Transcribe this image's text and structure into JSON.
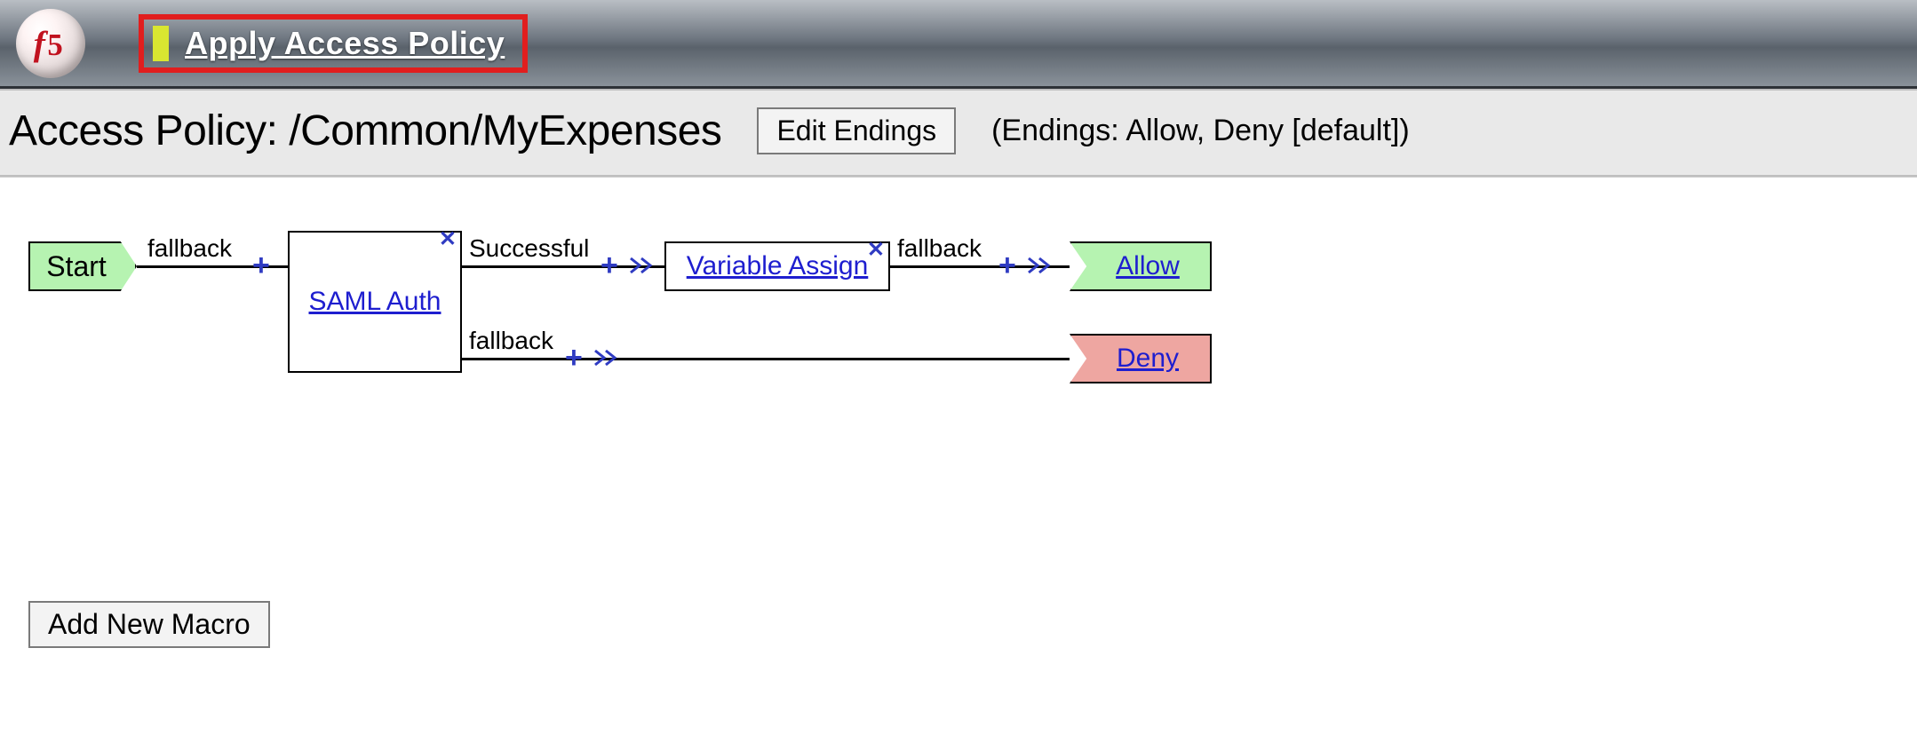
{
  "header": {
    "apply_label": "Apply Access Policy"
  },
  "policy": {
    "title": "Access Policy: /Common/MyExpenses",
    "edit_endings_label": "Edit Endings",
    "endings_desc": "(Endings: Allow, Deny [default])"
  },
  "flow": {
    "start_label": "Start",
    "start_branch": "fallback",
    "saml": {
      "label": "SAML Auth",
      "branch_success": "Successful",
      "branch_fallback": "fallback"
    },
    "var_assign": {
      "label": "Variable Assign",
      "branch_fallback": "fallback"
    },
    "endings": {
      "allow": "Allow",
      "deny": "Deny"
    }
  },
  "buttons": {
    "add_macro": "Add New Macro"
  },
  "glyphs": {
    "plus": "+",
    "close": "✕"
  }
}
